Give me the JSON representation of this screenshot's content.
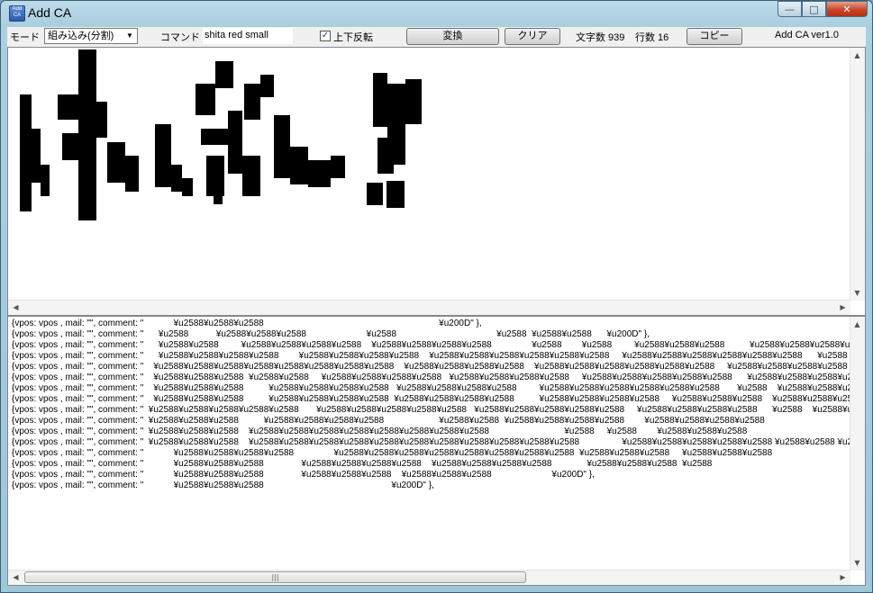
{
  "window": {
    "title": "Add CA",
    "icon_label": "Add CA",
    "controls": {
      "minimize": "—",
      "maximize": "□",
      "close": "✕"
    }
  },
  "toolbar": {
    "mode_label": "モード",
    "mode_value": "組み込み(分割)",
    "command_label": "コマンド",
    "command_value": "shita red small",
    "flip_label": "上下反転",
    "flip_checked": true,
    "convert_button": "変換",
    "clear_button": "クリア",
    "char_count": "文字数 939",
    "line_count": "行数 16",
    "copy_button": "コピー",
    "version": "Add CA ver1.0"
  },
  "preview": {
    "description_icon": "pixel-art-preview",
    "fill_color": "#000000"
  },
  "output": {
    "lines": [
      "{vpos: vpos , mail: \"\", comment: \"            ¥u2588¥u2588¥u2588                                                                      ¥u200D\" },",
      "{vpos: vpos , mail: \"\", comment: \"      ¥u2588           ¥u2588¥u2588¥u2588                        ¥u2588                                        ¥u2588  ¥u2588¥u2588      ¥u200D\" },",
      "{vpos: vpos , mail: \"\", comment: \"      ¥u2588¥u2588         ¥u2588¥u2588¥u2588¥u2588    ¥u2588¥u2588¥u2588¥u2588                ¥u2588        ¥u2588         ¥u2588¥u2588¥u2588          ¥u2588¥u2588¥u2588¥u2588",
      "{vpos: vpos , mail: \"\", comment: \"      ¥u2588¥u2588¥u2588¥u2588        ¥u2588¥u2588¥u2588¥u2588    ¥u2588¥u2588¥u2588¥u2588¥u2588¥u2588     ¥u2588¥u2588¥u2588¥u2588¥u2588¥u2588      ¥u2588         ¥u2588¥u2588¥u2588",
      "{vpos: vpos , mail: \"\", comment: \"    ¥u2588¥u2588¥u2588¥u2588¥u2588¥u2588¥u2588¥u2588    ¥u2588¥u2588¥u2588¥u2588    ¥u2588¥u2588¥u2588¥u2588¥u2588¥u2588     ¥u2588¥u2588¥u2588¥u2588 ¥u2588       ¥u2588¥u2588¥u2588     ¥u2",
      "{vpos: vpos , mail: \"\", comment: \"    ¥u2588¥u2588¥u2588  ¥u2588¥u2588     ¥u2588¥u2588¥u2588¥u2588   ¥u2588¥u2588¥u2588¥u2588     ¥u2588¥u2588¥u2588¥u2588¥u2588      ¥u2588¥u2588¥u2588¥u2588     ¥u2588¥u2588¥u2588¥u2588  ¥u2",
      "{vpos: vpos , mail: \"\", comment: \"    ¥u2588¥u2588¥u2588          ¥u2588¥u2588¥u2588¥u2588   ¥u2588¥u2588¥u2588¥u2588         ¥u2588¥u2588¥u2588¥u2588¥u2588¥u2588       ¥u2588    ¥u2588¥u2588¥u2588¥u2588¥u2588¥u2588",
      "{vpos: vpos , mail: \"\", comment: \"    ¥u2588¥u2588¥u2588          ¥u2588¥u2588¥u2588¥u2588  ¥u2588¥u2588¥u2588¥u2588          ¥u2588¥u2588¥u2588¥u2588     ¥u2588¥u2588¥u2588    ¥u2588¥u2588¥u2588¥u2588¥u2588",
      "{vpos: vpos , mail: \"\", comment: \"  ¥u2588¥u2588¥u2588¥u2588¥u2588       ¥u2588¥u2588¥u2588¥u2588¥u2588   ¥u2588¥u2588¥u2588¥u2588¥u2588     ¥u2588¥u2588¥u2588¥u2588      ¥u2588    ¥u2588¥u2588¥u2588¥u2588¥u2588",
      "{vpos: vpos , mail: \"\", comment: \"  ¥u2588¥u2588¥u2588          ¥u2588¥u2588¥u2588¥u2588                      ¥u2588¥u2588  ¥u2588¥u2588¥u2588¥u2588        ¥u2588¥u2588¥u2588¥u2588",
      "{vpos: vpos , mail: \"\", comment: \"  ¥u2588¥u2588¥u2588    ¥u2588¥u2588¥u2588¥u2588¥u2588¥u2588¥u2588¥u2588                              ¥u2588     ¥u2588        ¥u2588¥u2588¥u2588",
      "{vpos: vpos , mail: \"\", comment: \"  ¥u2588¥u2588¥u2588    ¥u2588¥u2588¥u2588¥u2588¥u2588¥u2588¥u2588¥u2588¥u2588¥u2588¥u2588                 ¥u2588¥u2588¥u2588¥u2588¥u2588 ¥u2588¥u2588 ¥u2588¥u2588",
      "{vpos: vpos , mail: \"\", comment: \"            ¥u2588¥u2588¥u2588¥u2588                ¥u2588¥u2588¥u2588¥u2588¥u2588¥u2588¥u2588¥u2588  ¥u2588¥u2588¥u2588     ¥u2588¥u2588¥u2588",
      "{vpos: vpos , mail: \"\", comment: \"            ¥u2588¥u2588¥u2588               ¥u2588¥u2588¥u2588¥u2588    ¥u2588¥u2588¥u2588¥u2588              ¥u2588¥u2588¥u2588  ¥u2588",
      "{vpos: vpos , mail: \"\", comment: \"            ¥u2588¥u2588¥u2588               ¥u2588¥u2588¥u2588    ¥u2588¥u2588¥u2588                        ¥u200D\" },",
      "{vpos: vpos , mail: \"\", comment: \"            ¥u2588¥u2588¥u2588                                                   ¥u200D\" },"
    ]
  },
  "scrollbar": {
    "grip": "|||"
  }
}
